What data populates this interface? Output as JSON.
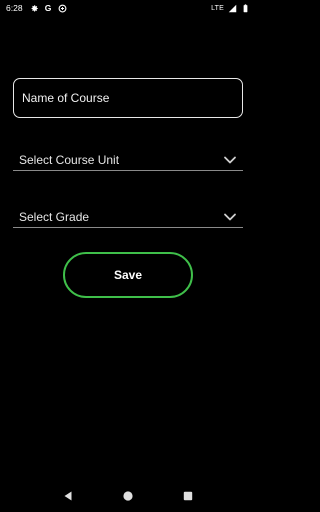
{
  "status_bar": {
    "time": "6:28",
    "icons": [
      "settings-icon",
      "google-icon",
      "sync-icon"
    ],
    "google_letter": "G",
    "network": "LTE"
  },
  "form": {
    "course_name_placeholder": "Name of Course",
    "course_unit_label": "Select Course Unit",
    "grade_label": "Select Grade",
    "save_label": "Save"
  },
  "colors": {
    "background": "#000000",
    "accent": "#3fbf4a",
    "field_border": "#e8e8e8"
  },
  "nav_bar": [
    "back-icon",
    "home-icon",
    "recents-icon"
  ]
}
